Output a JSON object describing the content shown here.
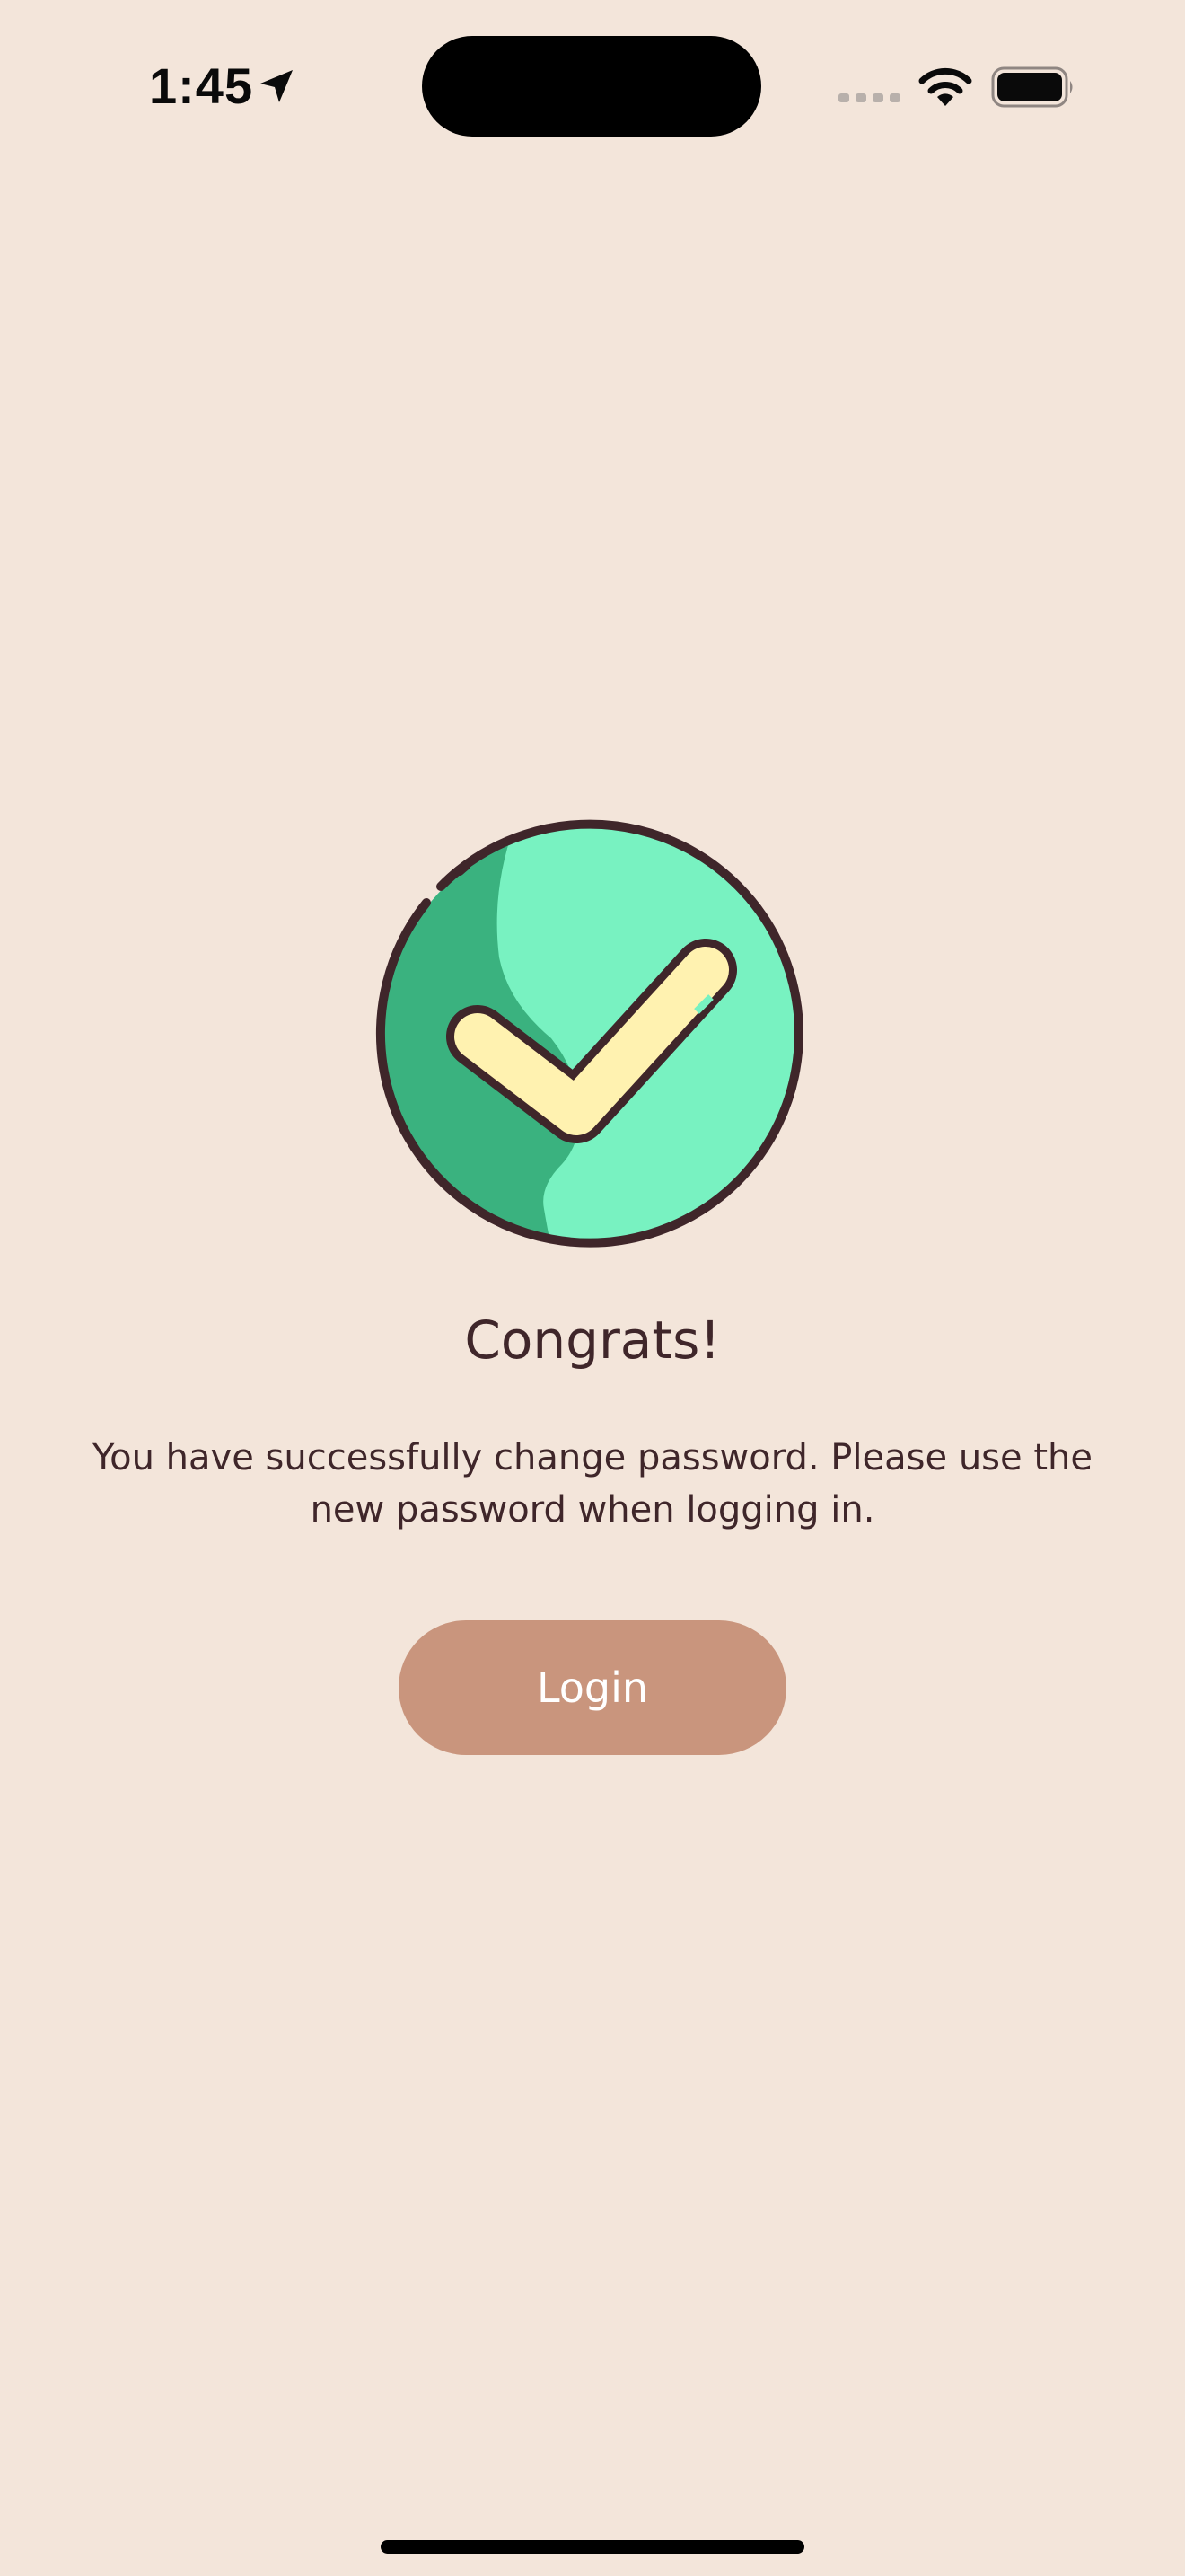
{
  "status_bar": {
    "time": "1:45",
    "icons": [
      "location-arrow-icon",
      "cellular-signal-icon",
      "wifi-icon",
      "battery-icon"
    ]
  },
  "illustration": {
    "icon": "checkmark-circle-icon",
    "colors": {
      "circle_light": "#78F2C1",
      "circle_dark": "#3AB27F",
      "check": "#FFF2B0",
      "outline": "#3F262A"
    }
  },
  "content": {
    "title": "Congrats!",
    "message": "You have successfully change password. Please use the new password when logging in."
  },
  "actions": {
    "login_label": "Login"
  },
  "colors": {
    "background": "#F3E5DA",
    "button": "#C9957D",
    "text": "#3F262A"
  }
}
